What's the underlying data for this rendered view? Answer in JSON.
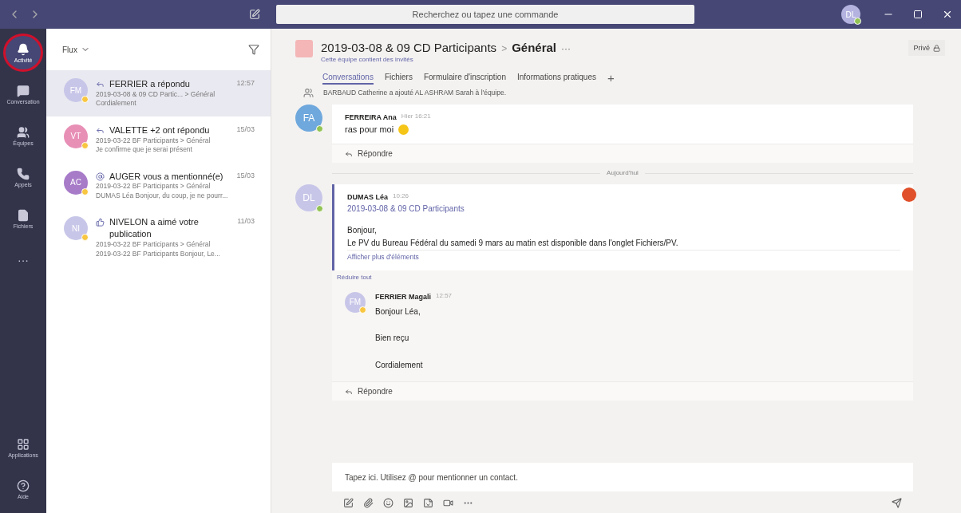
{
  "titlebar": {
    "search_placeholder": "Recherchez ou tapez une commande",
    "user_initials": "DL"
  },
  "rail": {
    "items": [
      {
        "label": "Activité",
        "selected": true
      },
      {
        "label": "Conversation",
        "selected": false
      },
      {
        "label": "Équipes",
        "selected": false
      },
      {
        "label": "Appels",
        "selected": false
      },
      {
        "label": "Fichiers",
        "selected": false
      },
      {
        "label": "···",
        "selected": false
      }
    ],
    "bottom": [
      {
        "label": "Applications"
      },
      {
        "label": "Aide"
      }
    ]
  },
  "feed": {
    "title": "Flux",
    "items": [
      {
        "initials": "FM",
        "color": "#c8c6e8",
        "available": false,
        "kind": "reply",
        "title": "FERRIER a répondu",
        "time": "12:57",
        "line1": "2019-03-08 & 09 CD Partic... > Général",
        "line2": "Cordialement",
        "selected": true
      },
      {
        "initials": "VT",
        "color": "#e88fb6",
        "available": false,
        "kind": "reply",
        "title": "VALETTE +2 ont répondu",
        "time": "15/03",
        "line1": "2019-03-22 BF Participants > Général",
        "line2": "Je confirme que je serai présent",
        "selected": false
      },
      {
        "initials": "AC",
        "color": "#a77bc8",
        "available": false,
        "kind": "mention",
        "title": "AUGER vous a mentionné(e)",
        "time": "15/03",
        "line1": "2019-03-22 BF Participants > Général",
        "line2": "DUMAS Léa Bonjour, du coup, je ne pourr...",
        "selected": false
      },
      {
        "initials": "NI",
        "color": "#c8c6e8",
        "available": false,
        "kind": "like",
        "title": "NIVELON a aimé votre publication",
        "time": "11/03",
        "line1": "2019-03-22 BF Participants > Général",
        "line2": "2019-03-22 BF Participants Bonjour, Le...",
        "selected": false
      }
    ]
  },
  "channel": {
    "team": "2019-03-08 & 09 CD Participants",
    "separator": ">",
    "name": "Général",
    "more": "···",
    "subtitle": "Cette équipe contient des invités",
    "privacy": "Privé",
    "tabs": [
      {
        "label": "Conversations",
        "selected": true
      },
      {
        "label": "Fichiers",
        "selected": false
      },
      {
        "label": "Formulaire d'inscription",
        "selected": false
      },
      {
        "label": "Informations pratiques",
        "selected": false
      }
    ],
    "add_tab": "+"
  },
  "system_message": "BARBAUD Catherine a ajouté AL ASHRAM Sarah à l'équipe.",
  "messages": [
    {
      "author": "FERREIRA Ana",
      "initials": "FA",
      "color": "#6fa8dc",
      "available": true,
      "time": "Hier 16:21",
      "lines": [
        "ras pour moi"
      ],
      "reply": "Répondre"
    }
  ],
  "date_divider": "Aujourd'hui",
  "thread": {
    "author": "DUMAS Léa",
    "initials": "DL",
    "color": "#c8c6e8",
    "available": true,
    "time": "10:26",
    "link": "2019-03-08 & 09 CD Participants",
    "lines": [
      "Bonjour,",
      "Le PV du Bureau Fédéral du samedi 9 mars au matin est disponible dans l'onglet Fichiers/PV."
    ],
    "show_more": "Afficher plus d'éléments",
    "collapse": "Réduire tout",
    "replies": [
      {
        "author": "FERRIER Magali",
        "initials": "FM",
        "color": "#c8c6e8",
        "available": false,
        "time": "12:57",
        "lines": [
          "Bonjour Léa,",
          "Bien reçu",
          "Cordialement"
        ]
      }
    ],
    "reply": "Répondre"
  },
  "compose": {
    "placeholder": "Tapez ici. Utilisez @ pour mentionner un contact."
  }
}
